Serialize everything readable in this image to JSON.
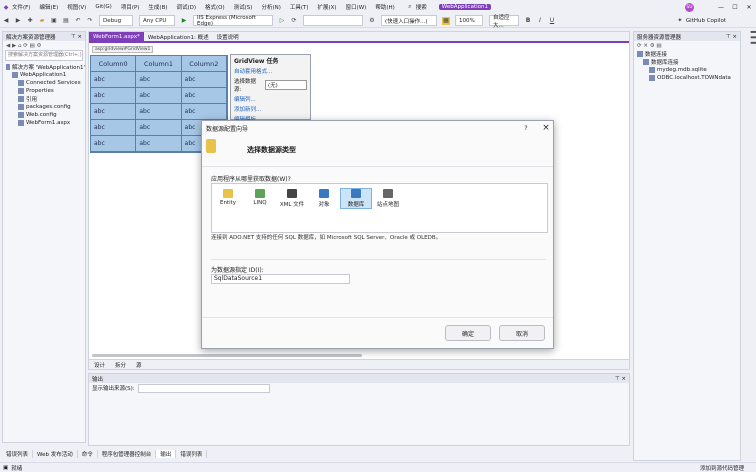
{
  "app": {
    "solution_name": "WebApplication1",
    "search_label": "搜索",
    "user_initials": "SU",
    "copilot": "GitHub Copilot"
  },
  "menu": [
    "文件(F)",
    "编辑(E)",
    "视图(V)",
    "Git(G)",
    "项目(P)",
    "生成(B)",
    "调试(D)",
    "格式(O)",
    "测试(S)",
    "分析(N)",
    "工具(T)",
    "扩展(X)",
    "窗口(W)",
    "帮助(H)"
  ],
  "toolbar": {
    "config": "Debug",
    "platform": "Any CPU",
    "run_target": "IIS Express (Microsoft Edge)",
    "target_combo": "(快速入口操作...)",
    "zoom": "100%",
    "misc": "自适应大..."
  },
  "solution_explorer": {
    "title": "解决方案资源管理器",
    "search_placeholder": "搜索解决方案资源管理器(Ctrl+;)",
    "items": [
      {
        "label": "解决方案 'WebApplication1'",
        "indent": 0
      },
      {
        "label": "WebApplication1",
        "indent": 1
      },
      {
        "label": "Connected Services",
        "indent": 2
      },
      {
        "label": "Properties",
        "indent": 2
      },
      {
        "label": "引用",
        "indent": 2
      },
      {
        "label": "packages.config",
        "indent": 2
      },
      {
        "label": "Web.config",
        "indent": 2
      },
      {
        "label": "WebForm1.aspx",
        "indent": 2
      }
    ]
  },
  "server_explorer": {
    "title": "服务器资源管理器",
    "items": [
      {
        "label": "数据连接",
        "indent": 0
      },
      {
        "label": "数据库连接",
        "indent": 1
      },
      {
        "label": "mydeg.mdb.sqlite",
        "indent": 2
      },
      {
        "label": "ODBC.localhost.TOWNdata",
        "indent": 2
      }
    ]
  },
  "tabs": [
    {
      "label": "WebForm1.aspx*",
      "active": true
    },
    {
      "label": "WebApplication1: 概述",
      "active": false
    },
    {
      "label": "设置说明",
      "active": false
    }
  ],
  "grid": {
    "id_label": "asp:gridview#GridView1",
    "columns": [
      "Column0",
      "Column1",
      "Column2"
    ],
    "rows": [
      [
        "abc",
        "abc",
        "abc"
      ],
      [
        "abc",
        "abc",
        "abc"
      ],
      [
        "abc",
        "abc",
        "abc"
      ],
      [
        "abc",
        "abc",
        "abc"
      ],
      [
        "abc",
        "abc",
        "abc"
      ]
    ]
  },
  "gridview_tasks": {
    "title": "GridView 任务",
    "autoformat": "自动套用格式...",
    "choose_source_label": "选择数据源:",
    "choose_source_value": "(无)",
    "links": [
      "编辑列...",
      "添加新列...",
      "编辑模板"
    ]
  },
  "editor_bottom_tabs": [
    "设计",
    "拆分",
    "源"
  ],
  "dialog": {
    "title": "数据源配置向导",
    "heading": "选择数据源类型",
    "question": "应用程序从哪里获取数据(W)?",
    "sources": [
      {
        "label": "Entity",
        "icon": "entity-icon"
      },
      {
        "label": "LINQ",
        "icon": "linq-icon"
      },
      {
        "label": "XML 文件",
        "icon": "xml-icon"
      },
      {
        "label": "对象",
        "icon": "object-icon"
      },
      {
        "label": "数据库",
        "icon": "database-icon",
        "selected": true
      },
      {
        "label": "站点地图",
        "icon": "sitemap-icon"
      }
    ],
    "description": "连接到 ADO.NET 支持的任何 SQL 数据库，如 Microsoft SQL Server、Oracle 或 OLEDB。",
    "id_label": "为数据源指定 ID(I):",
    "id_value": "SqlDataSource1",
    "ok": "确定",
    "cancel": "取消",
    "help": "?",
    "close": "×"
  },
  "output": {
    "title": "输出",
    "source_label": "显示输出来源(S):"
  },
  "bottom_tabs": [
    "错误列表",
    "Web 发布活动",
    "命令",
    "程序包管理器控制台",
    "输出",
    "错误列表"
  ],
  "status": {
    "left": "就绪",
    "right": "添加到源代码管理"
  }
}
